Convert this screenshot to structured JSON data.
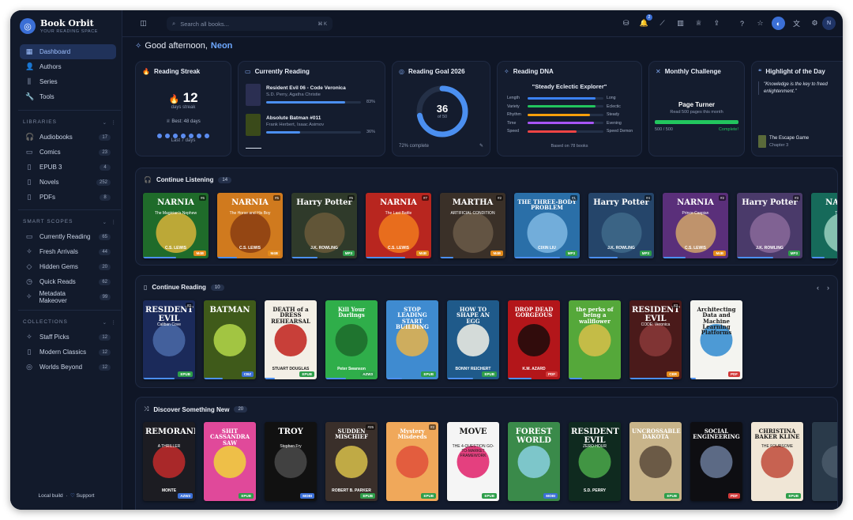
{
  "brand": {
    "name": "Book Orbit",
    "tagline": "YOUR READING SPACE"
  },
  "nav": [
    {
      "icon": "grid-icon",
      "glyph": "▦",
      "label": "Dashboard",
      "active": true
    },
    {
      "icon": "users-icon",
      "glyph": "👤",
      "label": "Authors"
    },
    {
      "icon": "series-icon",
      "glyph": "⫼",
      "label": "Series"
    },
    {
      "icon": "wrench-icon",
      "glyph": "🔧",
      "label": "Tools"
    }
  ],
  "libraries": {
    "title": "LIBRARIES",
    "items": [
      {
        "icon": "headphones-icon",
        "glyph": "🎧",
        "label": "Audiobooks",
        "count": "17"
      },
      {
        "icon": "comic-icon",
        "glyph": "▭",
        "label": "Comics",
        "count": "23"
      },
      {
        "icon": "book-icon",
        "glyph": "▯",
        "label": "EPUB 3",
        "count": "4"
      },
      {
        "icon": "book-icon",
        "glyph": "▯",
        "label": "Novels",
        "count": "252"
      },
      {
        "icon": "file-icon",
        "glyph": "▯",
        "label": "PDFs",
        "count": "8"
      }
    ]
  },
  "scopes": {
    "title": "SMART SCOPES",
    "items": [
      {
        "icon": "book-open-icon",
        "glyph": "▭",
        "label": "Currently Reading",
        "count": "65"
      },
      {
        "icon": "sparkles-icon",
        "glyph": "✧",
        "label": "Fresh Arrivals",
        "count": "44"
      },
      {
        "icon": "gem-icon",
        "glyph": "◇",
        "label": "Hidden Gems",
        "count": "20"
      },
      {
        "icon": "timer-icon",
        "glyph": "◷",
        "label": "Quick Reads",
        "count": "62"
      },
      {
        "icon": "sparkles-icon",
        "glyph": "✧",
        "label": "Metadata Makeover",
        "count": "99"
      }
    ]
  },
  "collections": {
    "title": "COLLECTIONS",
    "items": [
      {
        "icon": "sparkles-icon",
        "glyph": "✧",
        "label": "Staff Picks",
        "count": "12"
      },
      {
        "icon": "book-icon",
        "glyph": "▯",
        "label": "Modern Classics",
        "count": "12"
      },
      {
        "icon": "globe-icon",
        "glyph": "◎",
        "label": "Worlds Beyond",
        "count": "12"
      }
    ]
  },
  "footer": {
    "left": "Local build",
    "right": "Support"
  },
  "topbar": {
    "search_placeholder": "Search all books...",
    "shortcut": "⌘ K",
    "notif_count": "2",
    "avatar": "N"
  },
  "greeting": {
    "prefix": "Good afternoon,",
    "name": "Neon"
  },
  "streak": {
    "title": "Reading Streak",
    "value": "12",
    "label": "days streak",
    "best": "Best: 48 days",
    "caption": "Last 7 days"
  },
  "current": {
    "title": "Currently Reading",
    "books": [
      {
        "title": "Resident Evil 06 - Code Veronica",
        "author": "S.D. Perry, Agatha Christie",
        "percent": "83%",
        "progress": 0.83
      },
      {
        "title": "Absolute Batman #011",
        "author": "Frank Herbert, Isaac Asimov",
        "percent": "36%",
        "progress": 0.36
      }
    ]
  },
  "goal": {
    "title": "Reading Goal 2026",
    "value": "36",
    "of": "of 50",
    "progress": 0.72,
    "caption": "72% complete"
  },
  "dna": {
    "title": "Reading DNA",
    "profile": "\"Steady Eclectic Explorer\"",
    "rows": [
      {
        "left": "Length",
        "right": "Long",
        "value": 0.9,
        "color": "#3b82f6"
      },
      {
        "left": "Variety",
        "right": "Eclectic",
        "value": 0.9,
        "color": "#22c55e"
      },
      {
        "left": "Rhythm",
        "right": "Steady",
        "value": 0.82,
        "color": "#f59e0b"
      },
      {
        "left": "Time",
        "right": "Evening",
        "value": 0.88,
        "color": "#a855f7"
      },
      {
        "left": "Speed",
        "right": "Speed Demon",
        "value": 0.65,
        "color": "#ef4444"
      }
    ],
    "caption": "Based on 78 books"
  },
  "challenge": {
    "title": "Monthly Challenge",
    "name": "Page Turner",
    "desc": "Read 500 pages this month",
    "count": "500 / 500",
    "status": "Complete!",
    "progress": 1.0
  },
  "highlight": {
    "title": "Highlight of the Day",
    "quote": "\"Knowledge is the key to freed enlightenment.\"",
    "book": "The Escape Game",
    "chapter": "Chapter 3"
  },
  "listening": {
    "title": "Continue Listening",
    "count": "14",
    "books": [
      {
        "title": "NARNIA",
        "sub": "The Magician's Nephew",
        "author": "C.S. LEWIS",
        "bg": "#1f6b2a",
        "art": "#d8b33a",
        "num": "#6",
        "fmt": "M4B",
        "fmtc": "#e38b1a",
        "prog": 0.5
      },
      {
        "title": "NARNIA",
        "sub": "The Horse and His Boy",
        "author": "C.S. LEWIS",
        "bg": "#d07a1e",
        "art": "#8a3d12",
        "num": "#5",
        "fmt": "M4B",
        "fmtc": "#e38b1a",
        "prog": 0.3
      },
      {
        "title": "Harry Potter",
        "sub": "",
        "author": "J.K. ROWLING",
        "bg": "#2f3a2a",
        "art": "#6a5a3a",
        "num": "#5",
        "fmt": "MP3",
        "fmtc": "#2e9e4a",
        "prog": 0.4
      },
      {
        "title": "NARNIA",
        "sub": "The Last Battle",
        "author": "C.S. LEWIS",
        "bg": "#b8261f",
        "art": "#f07a1d",
        "num": "#7",
        "fmt": "M4B",
        "fmtc": "#e38b1a",
        "prog": 0.6
      },
      {
        "title": "MARTHA",
        "sub": "ARTIFICIAL CONDITION",
        "author": "",
        "bg": "#3a3028",
        "art": "#6b5a48",
        "num": "#2",
        "fmt": "M4B",
        "fmtc": "#e38b1a",
        "prog": 0.2
      },
      {
        "title": "THE THREE-BODY PROBLEM",
        "sub": "",
        "author": "CIXIN LIU",
        "bg": "#2a6fa8",
        "art": "#7fb9e3",
        "num": "#1",
        "fmt": "MP3",
        "fmtc": "#2e9e4a",
        "prog": 0.7
      },
      {
        "title": "Harry Potter",
        "sub": "",
        "author": "J.K. ROWLING",
        "bg": "#25456a",
        "art": "#3f6a8a",
        "num": "#4",
        "fmt": "MP3",
        "fmtc": "#2e9e4a",
        "prog": 0.45
      },
      {
        "title": "NARNIA",
        "sub": "Prince Caspian",
        "author": "C.S. LEWIS",
        "bg": "#5a2f7a",
        "art": "#d1a56a",
        "num": "#2",
        "fmt": "M4B",
        "fmtc": "#e38b1a",
        "prog": 0.35
      },
      {
        "title": "Harry Potter",
        "sub": "",
        "author": "J.K. ROWLING",
        "bg": "#4a3a6a",
        "art": "#8a6a9a",
        "num": "#3",
        "fmt": "MP3",
        "fmtc": "#2e9e4a",
        "prog": 0.55
      },
      {
        "title": "NARNIA",
        "sub": "The Silver",
        "author": "",
        "bg": "#166a5a",
        "art": "#9ad0c0",
        "num": "",
        "fmt": "",
        "fmtc": "#2e9e4a",
        "prog": 0.2
      }
    ]
  },
  "reading": {
    "title": "Continue Reading",
    "count": "10",
    "books": [
      {
        "title": "RESIDENT EVIL",
        "sub": "Caliban Cove",
        "author": "",
        "bg": "#1b2a5a",
        "art": "#4a6aa8",
        "num": "#2",
        "fmt": "EPUB",
        "fmtc": "#2e9e4a",
        "prog": 0.6
      },
      {
        "title": "BATMAN",
        "sub": "",
        "author": "",
        "bg": "#3f5a1a",
        "art": "#b4d84a",
        "num": "",
        "fmt": "CBZ",
        "fmtc": "#3b6fd6",
        "prog": 0.36
      },
      {
        "title": "DEATH of a DRESS REHEARSAL",
        "sub": "",
        "author": "STUART DOUGLAS",
        "bg": "#f3efe6",
        "art": "#c0201a",
        "num": "",
        "fmt": "EPUB",
        "fmtc": "#2e9e4a",
        "prog": 0.2,
        "dark": true
      },
      {
        "title": "Kill Your Darlings",
        "sub": "",
        "author": "Peter Swanson",
        "bg": "#2fae4a",
        "art": "#1c6a2a",
        "num": "",
        "fmt": "AZW3",
        "fmtc": "#2e9e4a",
        "prog": 0.4
      },
      {
        "title": "STOP LEADING START BUILDING",
        "sub": "",
        "author": "",
        "bg": "#3f8bd0",
        "art": "#e8b34a",
        "num": "",
        "fmt": "EPUB",
        "fmtc": "#2e9e4a",
        "prog": 0.3
      },
      {
        "title": "HOW TO SHAPE AN EGG",
        "sub": "",
        "author": "BONNY REICHERT",
        "bg": "#1f5a8a",
        "art": "#f5f2e6",
        "num": "",
        "fmt": "EPUB",
        "fmtc": "#2e9e4a",
        "prog": 0.5
      },
      {
        "title": "DROP DEAD GORGEOUS",
        "sub": "",
        "author": "K.M. AZARD",
        "bg": "#b3161a",
        "art": "#1a0a0a",
        "num": "",
        "fmt": "PDF",
        "fmtc": "#d23a3a",
        "prog": 0.45
      },
      {
        "title": "the perks of being a wallflower",
        "sub": "",
        "author": "",
        "bg": "#55a83a",
        "art": "#d8c04a",
        "num": "",
        "fmt": "",
        "fmtc": "#2e9e4a",
        "prog": 0.25
      },
      {
        "title": "RESIDENT EVIL",
        "sub": "CODE: Veronica",
        "author": "",
        "bg": "#4a1a1a",
        "art": "#8a3a3a",
        "num": "#3",
        "fmt": "CBR",
        "fmtc": "#e38b1a",
        "prog": 0.83
      },
      {
        "title": "Architecting Data and Machine Learning Platforms",
        "sub": "",
        "author": "",
        "bg": "#f4f4f0",
        "art": "#2f8ad0",
        "num": "",
        "fmt": "PDF",
        "fmtc": "#d23a3a",
        "prog": 0.1,
        "dark": true
      }
    ]
  },
  "discover": {
    "title": "Discover Something New",
    "count": "20",
    "books": [
      {
        "title": "REMORANDOM",
        "sub": "A THRILLER",
        "author": "MONTE",
        "bg": "#1c1c22",
        "art": "#c22a2a",
        "num": "",
        "fmt": "AZW3",
        "fmtc": "#3b6fd6",
        "prog": 0
      },
      {
        "title": "SHIT CASSANDRA SAW",
        "sub": "",
        "author": "",
        "bg": "#e0499a",
        "art": "#f0d43a",
        "num": "",
        "fmt": "EPUB",
        "fmtc": "#2e9e4a",
        "prog": 0
      },
      {
        "title": "TROY",
        "sub": "Stephen Fry",
        "author": "",
        "bg": "#111111",
        "art": "#4a4a4a",
        "num": "",
        "fmt": "MOBI",
        "fmtc": "#3b6fd6",
        "prog": 0
      },
      {
        "title": "SUDDEN MISCHIEF",
        "sub": "",
        "author": "ROBERT B. PARKER",
        "bg": "#3a2f2a",
        "art": "#d8c04a",
        "num": "#25",
        "fmt": "EPUB",
        "fmtc": "#2e9e4a",
        "prog": 0
      },
      {
        "title": "Mystery Misdeeds",
        "sub": "",
        "author": "",
        "bg": "#f0a85a",
        "art": "#e0503a",
        "num": "#2",
        "fmt": "EPUB",
        "fmtc": "#2e9e4a",
        "prog": 0
      },
      {
        "title": "MOVE",
        "sub": "THE 4-QUESTION GO-TO-MARKET FRAMEWORK",
        "author": "",
        "bg": "#f5f5f5",
        "art": "#e0206a",
        "num": "",
        "fmt": "EPUB",
        "fmtc": "#2e9e4a",
        "prog": 0,
        "dark": true
      },
      {
        "title": "FOREST WORLD",
        "sub": "",
        "author": "",
        "bg": "#3a8a4a",
        "art": "#8ad0e0",
        "num": "",
        "fmt": "MOBI",
        "fmtc": "#3b6fd6",
        "prog": 0
      },
      {
        "title": "RESIDENT EVIL",
        "sub": "ZERO HOUR",
        "author": "S.D. PERRY",
        "bg": "#0f2a1f",
        "art": "#4aa84a",
        "num": "",
        "fmt": "",
        "fmtc": "#2e9e4a",
        "prog": 0
      },
      {
        "title": "UNCROSSABLE DAKOTA",
        "sub": "",
        "author": "",
        "bg": "#c8b48a",
        "art": "#5a4a3a",
        "num": "",
        "fmt": "EPUB",
        "fmtc": "#2e9e4a",
        "prog": 0
      },
      {
        "title": "SOCIAL ENGINEERING",
        "sub": "",
        "author": "",
        "bg": "#0e0e12",
        "art": "#6a7a9a",
        "num": "",
        "fmt": "PDF",
        "fmtc": "#d23a3a",
        "prog": 0
      },
      {
        "title": "CHRISTINA BAKER KLINE",
        "sub": "THE FOURSOME",
        "author": "",
        "bg": "#f0e6d6",
        "art": "#c04a3a",
        "num": "",
        "fmt": "EPUB",
        "fmtc": "#2e9e4a",
        "prog": 0,
        "dark": true
      },
      {
        "title": "",
        "sub": "",
        "author": "",
        "bg": "#2a3a4a",
        "art": "#4a5a6a",
        "num": "",
        "fmt": "",
        "fmtc": "#2e9e4a",
        "prog": 0
      }
    ]
  }
}
